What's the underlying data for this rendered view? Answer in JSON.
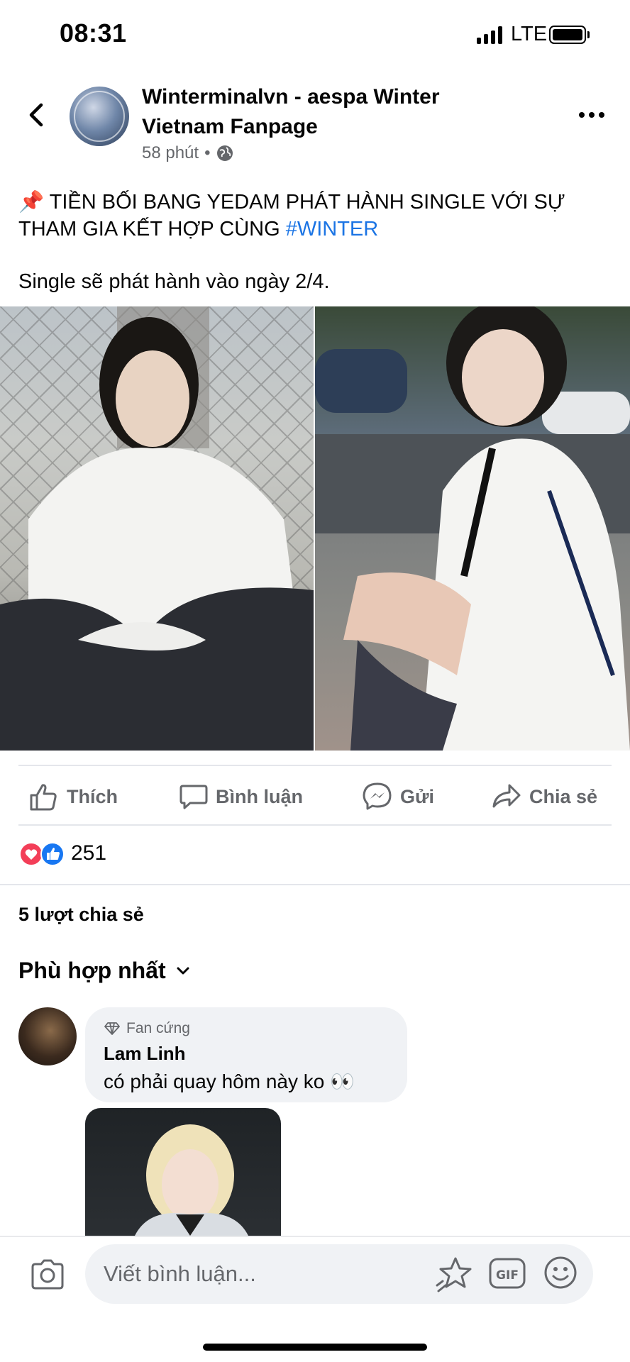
{
  "status_bar": {
    "time": "08:31",
    "network": "LTE"
  },
  "header": {
    "page_name": "Winterminalvn - aespa Winter Vietnam Fanpage",
    "time_ago": "58 phút",
    "separator": "•"
  },
  "post": {
    "pin_emoji": "📌",
    "title": "TIỀN BỐI BANG YEDAM PHÁT HÀNH SINGLE VỚI SỰ THAM GIA KẾT HỢP CÙNG",
    "hashtag": "#WINTER",
    "body": "Single sẽ phát hành vào ngày 2/4."
  },
  "actions": {
    "like": "Thích",
    "comment": "Bình luận",
    "send": "Gửi",
    "share": "Chia sẻ"
  },
  "stats": {
    "reactions": "251",
    "shares": "5 lượt chia sẻ"
  },
  "comments": {
    "sort_label": "Phù hợp nhất",
    "items": [
      {
        "badge": "Fan cứng",
        "name": "Lam Linh",
        "text": "có phải quay hôm này ko 👀"
      }
    ]
  },
  "composer": {
    "placeholder": "Viết bình luận..."
  },
  "colors": {
    "accent": "#1b74e4",
    "love": "#f33e58",
    "like": "#1877f2",
    "muted": "#65676b"
  }
}
